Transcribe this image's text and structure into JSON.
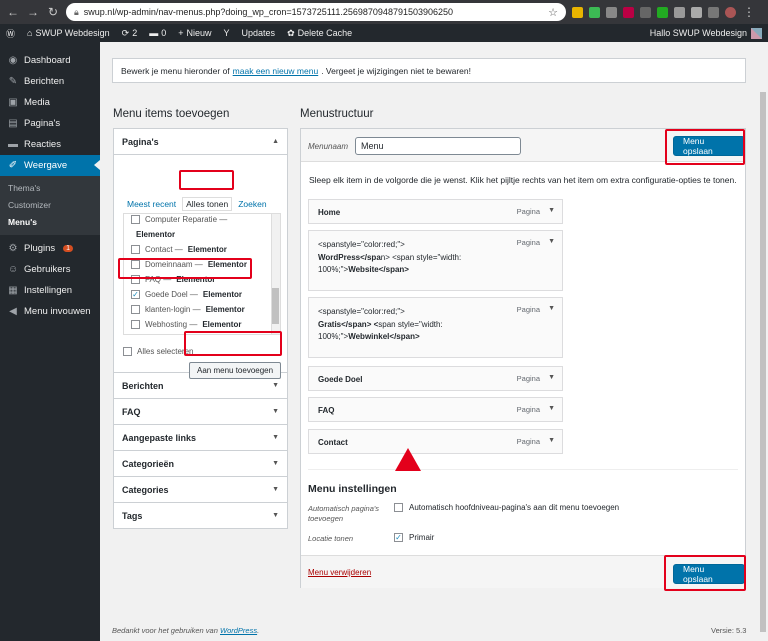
{
  "browser": {
    "url": "swup.nl/wp-admin/nav-menus.php?doing_wp_cron=1573725111.2569870948791503906250",
    "back_icon": "arrow-left-icon",
    "forward_icon": "arrow-right-icon",
    "reload_icon": "reload-icon"
  },
  "adminbar": {
    "site_name": "SWUP Webdesign",
    "updates_count": "2",
    "comments_count": "0",
    "new_label": "Nieuw",
    "updates_label": "Updates",
    "cache_label": "Delete Cache",
    "greeting": "Hallo SWUP Webdesign"
  },
  "sidebar": {
    "items": [
      {
        "label": "Dashboard",
        "icon": "dashboard-icon",
        "glyph": "◉"
      },
      {
        "label": "Berichten",
        "icon": "pin-icon",
        "glyph": "✎"
      },
      {
        "label": "Media",
        "icon": "media-icon",
        "glyph": "▣"
      },
      {
        "label": "Pagina's",
        "icon": "page-icon",
        "glyph": "▤"
      },
      {
        "label": "Reacties",
        "icon": "comment-icon",
        "glyph": "▬"
      },
      {
        "label": "Weergave",
        "icon": "brush-icon",
        "glyph": "✐"
      }
    ],
    "sub_items": [
      "Thema's",
      "Customizer",
      "Menu's"
    ],
    "items2": [
      {
        "label": "Plugins",
        "icon": "plugin-icon",
        "glyph": "⚙",
        "badge": "1"
      },
      {
        "label": "Gebruikers",
        "icon": "users-icon",
        "glyph": "☺"
      },
      {
        "label": "Instellingen",
        "icon": "settings-icon",
        "glyph": "▦"
      },
      {
        "label": "Menu invouwen",
        "icon": "collapse-icon",
        "glyph": "◀"
      }
    ]
  },
  "notice": {
    "before": "Bewerk je menu hieronder of",
    "link": "maak een nieuw menu",
    "after": ". Vergeet je wijzigingen niet te bewaren!"
  },
  "left": {
    "title": "Menu items toevoegen",
    "pages_title": "Pagina's",
    "tabs": [
      "Meest recent",
      "Alles tonen",
      "Zoeken"
    ],
    "pages": [
      {
        "name": "Computer Reparatie —",
        "suffix": "",
        "checked": false,
        "partial": true
      },
      {
        "name": "",
        "suffix": "Elementor",
        "checked": false,
        "noBox": true
      },
      {
        "name": "Contact — ",
        "suffix": "Elementor",
        "checked": false
      },
      {
        "name": "Domeinnaam — ",
        "suffix": "Elementor",
        "checked": false
      },
      {
        "name": "FAQ — ",
        "suffix": "Elementor",
        "checked": false
      },
      {
        "name": "Goede Doel — ",
        "suffix": "Elementor",
        "checked": true
      },
      {
        "name": "klanten-login — ",
        "suffix": "Elementor",
        "checked": false
      },
      {
        "name": "Webhosting — ",
        "suffix": "Elementor",
        "checked": false
      }
    ],
    "select_all": "Alles selecteren",
    "add_button": "Aan menu toevoegen",
    "sections": [
      "Berichten",
      "FAQ",
      "Aangepaste links",
      "Categorieën",
      "Categories",
      "Tags"
    ]
  },
  "right": {
    "title": "Menustructuur",
    "menu_name_label": "Menunaam",
    "menu_name_value": "Menu",
    "save_label": "Menu opslaan",
    "instructions": "Sleep elk item in de volgorde die je wenst. Klik het pijltje rechts van het item om extra configuratie-opties te tonen.",
    "item_type": "Pagina",
    "items": [
      {
        "title": "Home"
      },
      {
        "multi": [
          "<span",
          "style=\"color:red;\">",
          "WordPress</spa",
          "n> <span style=\"width:",
          "100%;\">",
          "Website</span>"
        ]
      },
      {
        "multi": [
          "<span",
          "style=\"color:red;\">",
          "Gratis</span> <",
          "span style=\"width:",
          "100%;\">",
          "Webwinkel</span>"
        ]
      },
      {
        "title": "Goede Doel"
      },
      {
        "title": "FAQ"
      },
      {
        "title": "Contact"
      }
    ],
    "settings_title": "Menu instellingen",
    "auto_label": "Automatisch pagina's toevoegen",
    "auto_option": "Automatisch hoofdniveau-pagina's aan dit menu toevoegen",
    "location_label": "Locatie tonen",
    "location_option": "Primair",
    "delete_label": "Menu verwijderen"
  },
  "footer": {
    "text": "Bedankt voor het gebruiken van",
    "link": "WordPress",
    "dot": ".",
    "version": "Versie: 5.3"
  },
  "colors": {
    "accent": "#0073aa",
    "highlight": "#e3001b",
    "sidebar": "#23282d"
  }
}
